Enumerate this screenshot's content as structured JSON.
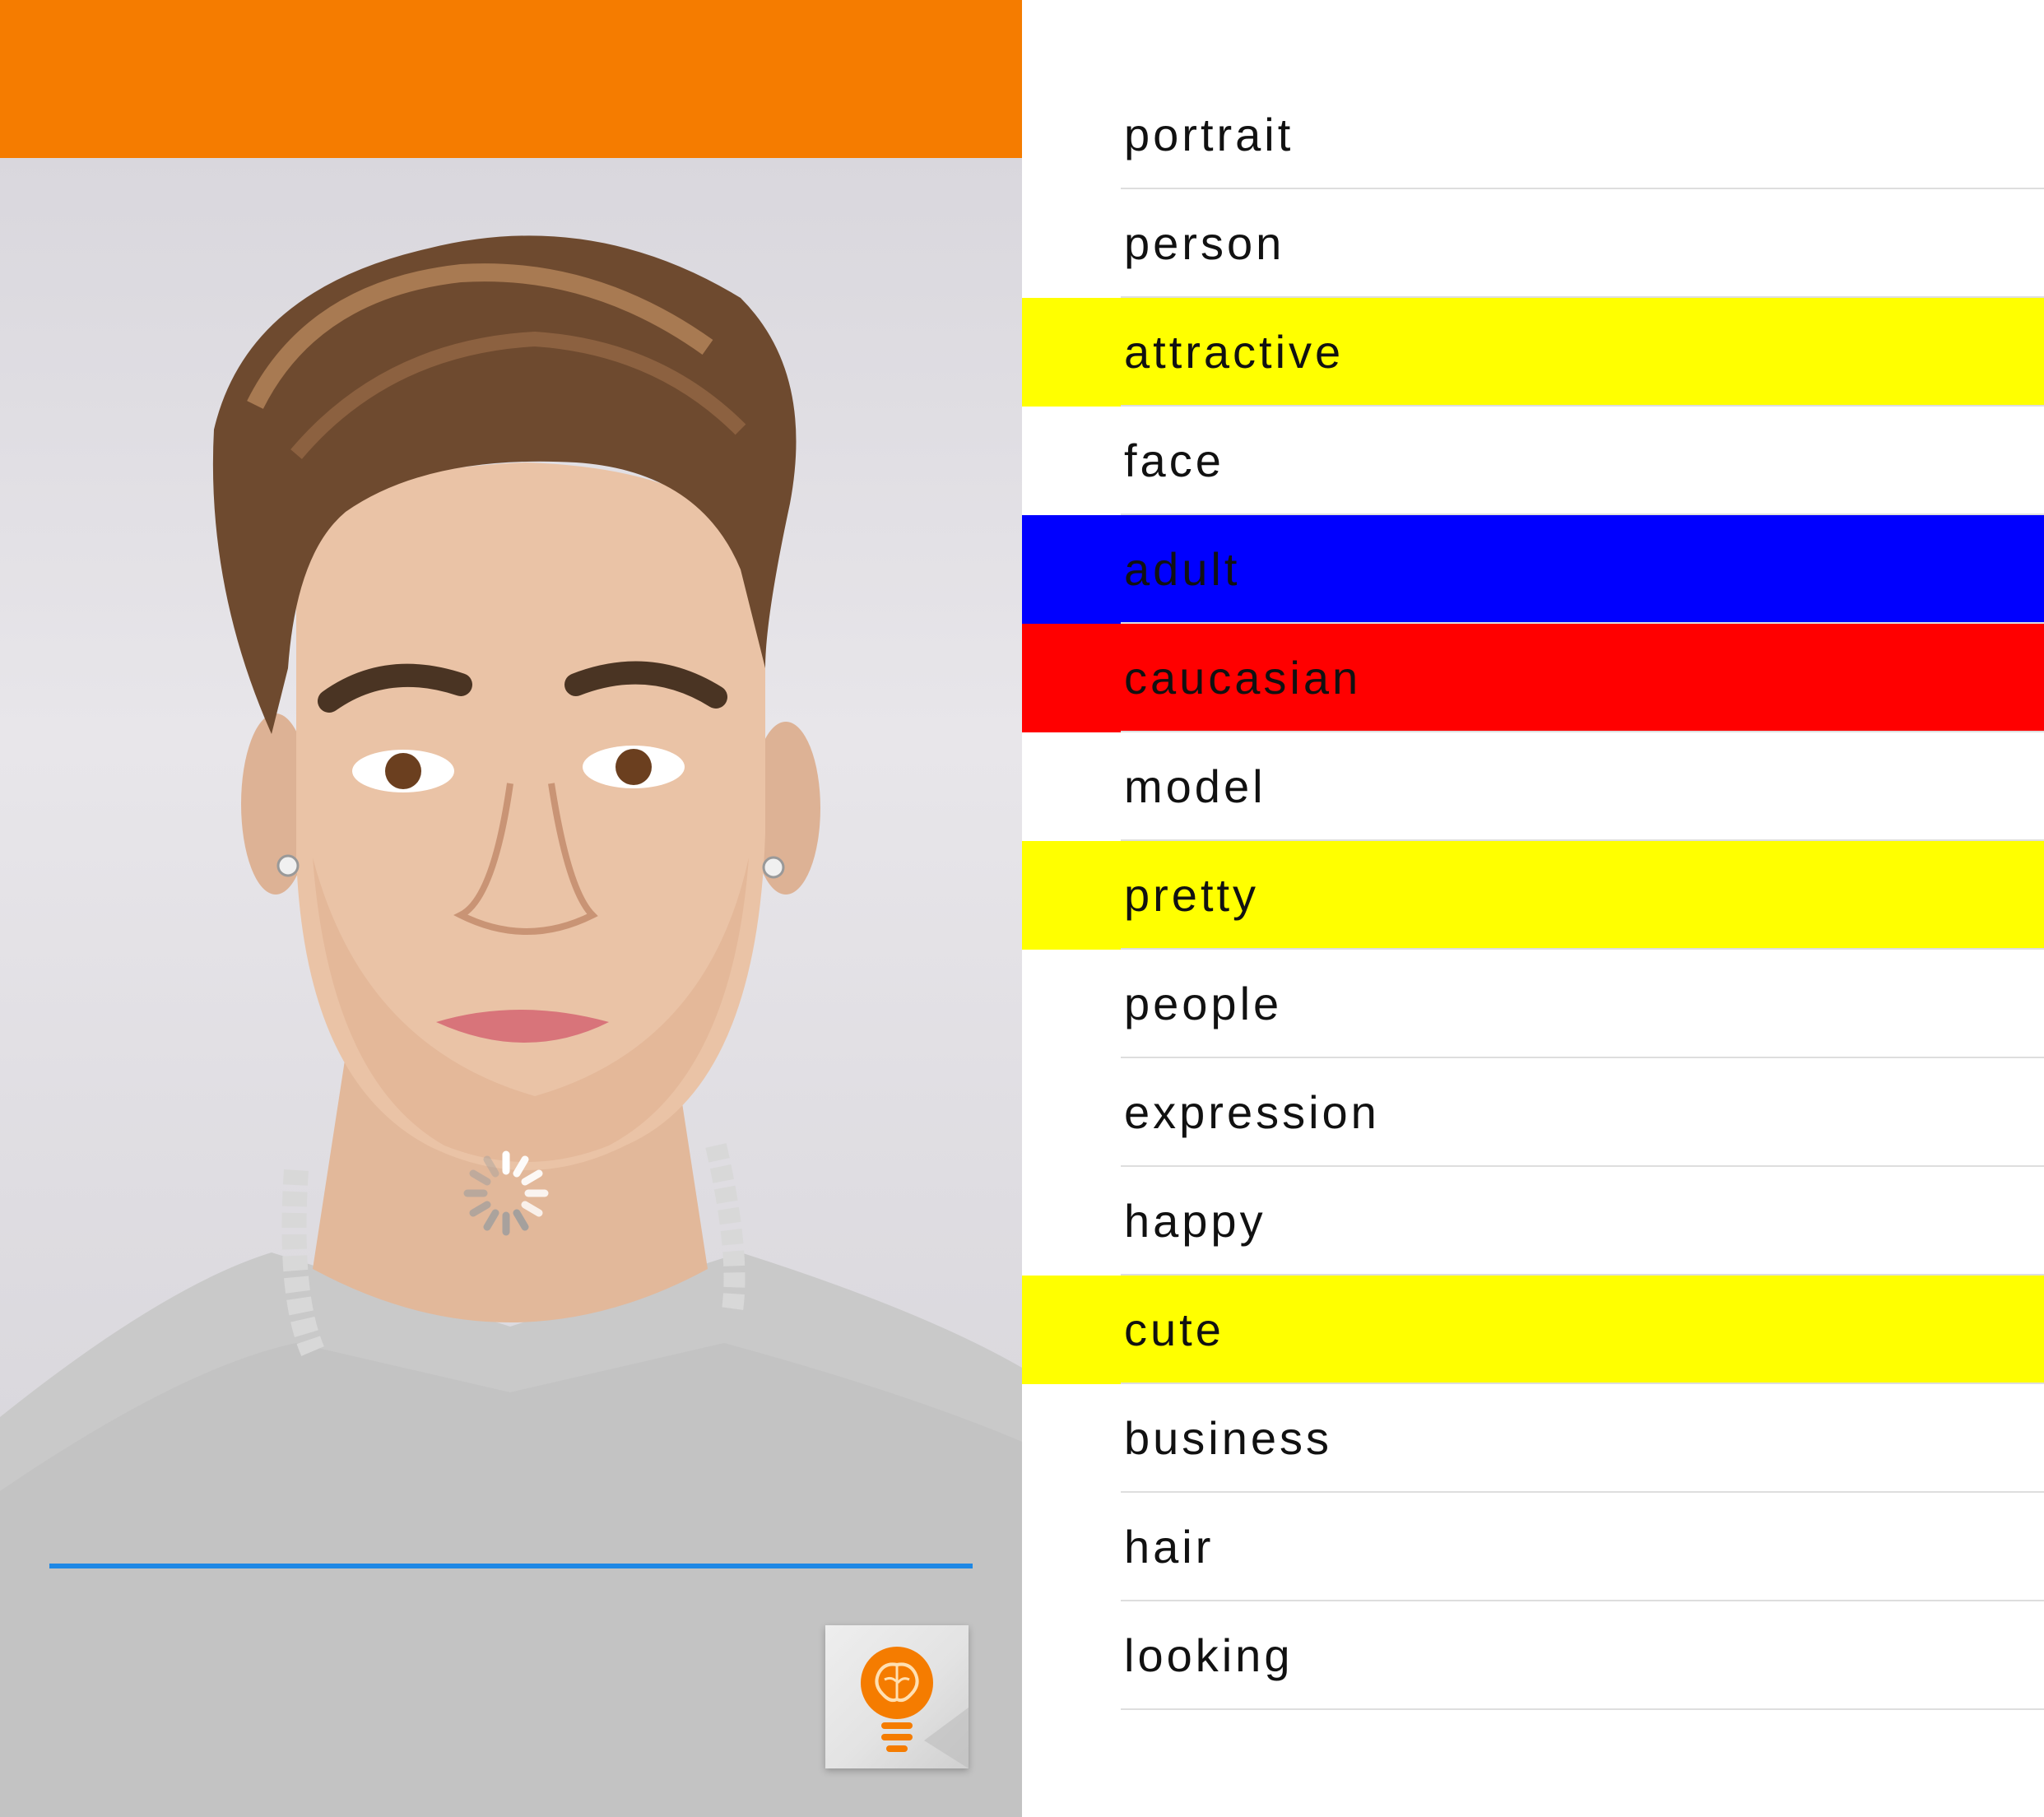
{
  "app": {
    "accent_color": "#F57C00",
    "progress_color": "#1E88E5",
    "fab_icon": "brain-lightbulb-icon",
    "loading_icon": "spinner-icon"
  },
  "tags": [
    {
      "label": "portrait",
      "highlight": "#FFFFFF"
    },
    {
      "label": "person",
      "highlight": "#FFFFFF"
    },
    {
      "label": "attractive",
      "highlight": "#FFFF00"
    },
    {
      "label": "face",
      "highlight": "#FFFFFF"
    },
    {
      "label": "adult",
      "highlight": "#0000FF"
    },
    {
      "label": "caucasian",
      "highlight": "#FF0000"
    },
    {
      "label": "model",
      "highlight": "#FFFFFF"
    },
    {
      "label": "pretty",
      "highlight": "#FFFF00"
    },
    {
      "label": "people",
      "highlight": "#FFFFFF"
    },
    {
      "label": "expression",
      "highlight": "#FFFFFF"
    },
    {
      "label": "happy",
      "highlight": "#FFFFFF"
    },
    {
      "label": "cute",
      "highlight": "#FFFF00"
    },
    {
      "label": "business",
      "highlight": "#FFFFFF"
    },
    {
      "label": "hair",
      "highlight": "#FFFFFF"
    },
    {
      "label": "looking",
      "highlight": "#FFFFFF"
    }
  ]
}
